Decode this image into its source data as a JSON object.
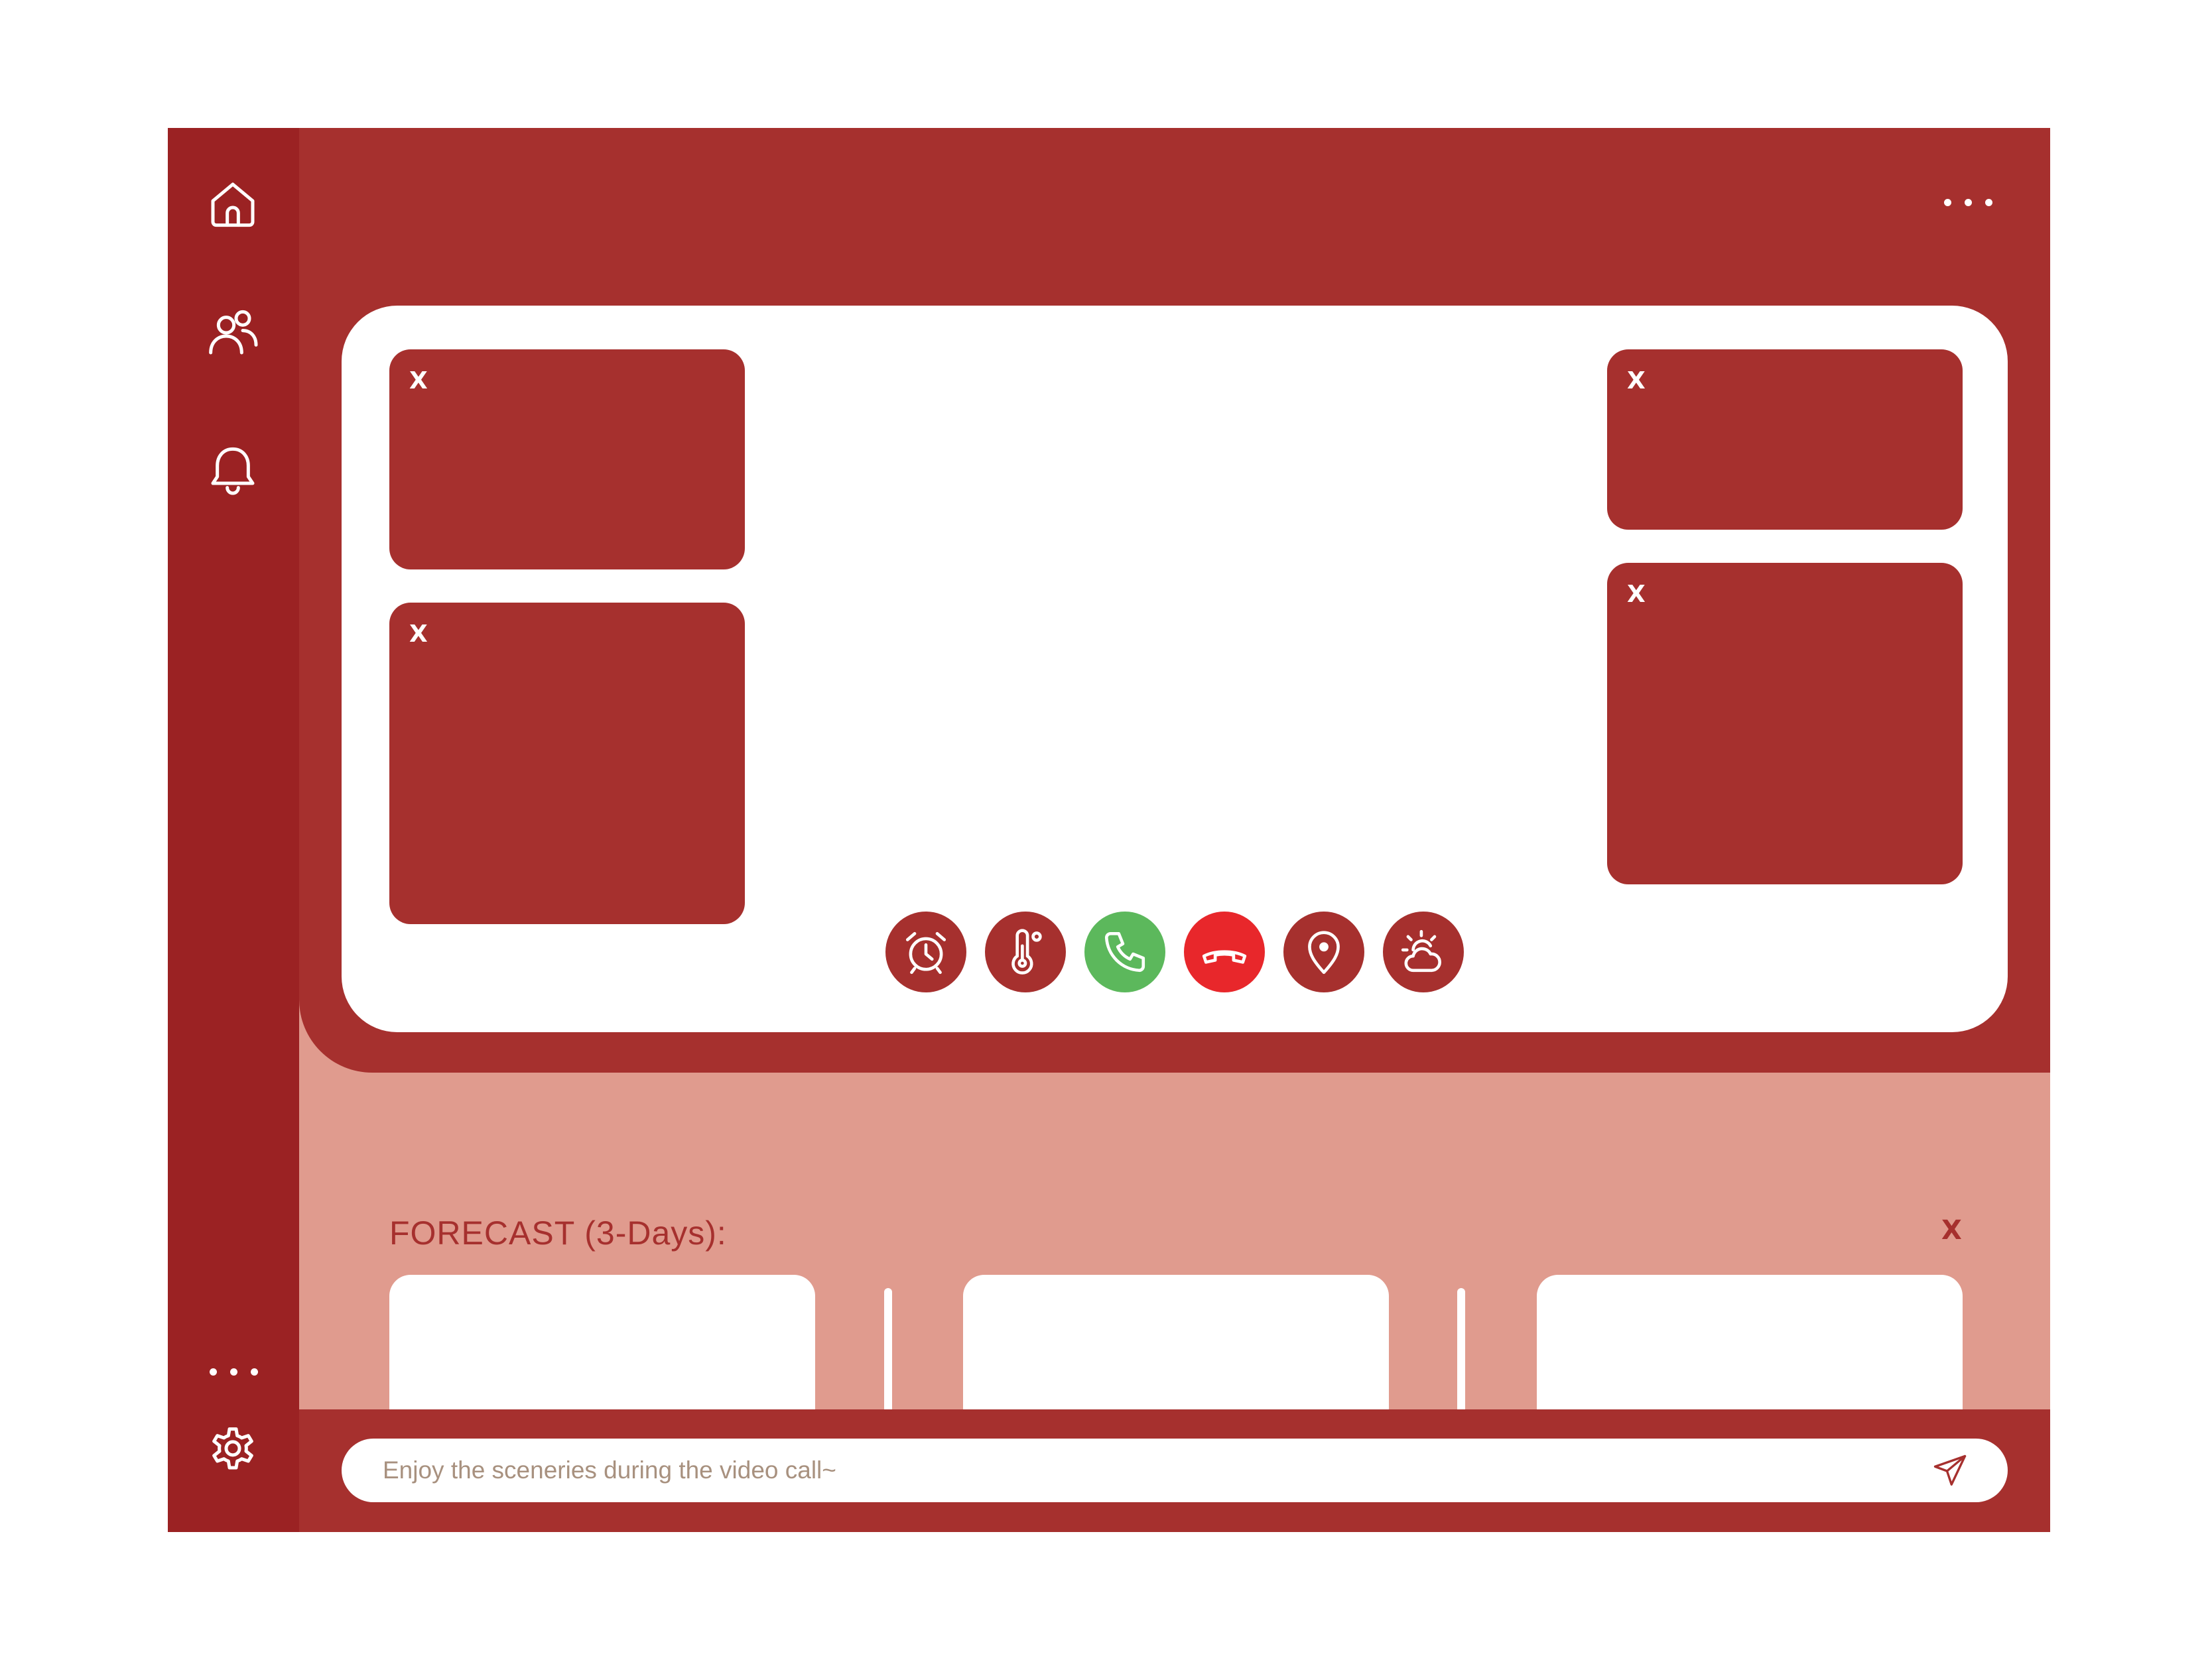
{
  "sidebar": {
    "top_icons": [
      "home-icon",
      "people-icon",
      "bell-icon"
    ],
    "bottom_icons": [
      "more-icon",
      "gear-icon"
    ]
  },
  "header": {
    "menu_icon": "more-horizontal-icon"
  },
  "video": {
    "tiles": [
      {
        "close_label": "X"
      },
      {
        "close_label": "X"
      },
      {
        "close_label": "X"
      },
      {
        "close_label": "X"
      }
    ],
    "controls": [
      {
        "icon": "alarm-clock-icon",
        "color": "#a6302e"
      },
      {
        "icon": "thermometer-icon",
        "color": "#a6302e"
      },
      {
        "icon": "phone-accept-icon",
        "color": "#5cb85c"
      },
      {
        "icon": "phone-hangup-icon",
        "color": "#e8272b"
      },
      {
        "icon": "location-pin-icon",
        "color": "#a6302e"
      },
      {
        "icon": "weather-sun-cloud-icon",
        "color": "#a6302e"
      }
    ]
  },
  "forecast": {
    "title": "FORECAST (3-Days):",
    "close_label": "X",
    "days": [
      {},
      {},
      {}
    ]
  },
  "chat": {
    "placeholder": "Enjoy the sceneries during the video call~",
    "send_icon": "send-icon"
  },
  "colors": {
    "primary": "#a6302e",
    "sidebar": "#9b2223",
    "forecast_bg": "#e09b8e",
    "accept": "#5cb85c",
    "hangup": "#e8272b",
    "placeholder_text": "#a8917f"
  }
}
